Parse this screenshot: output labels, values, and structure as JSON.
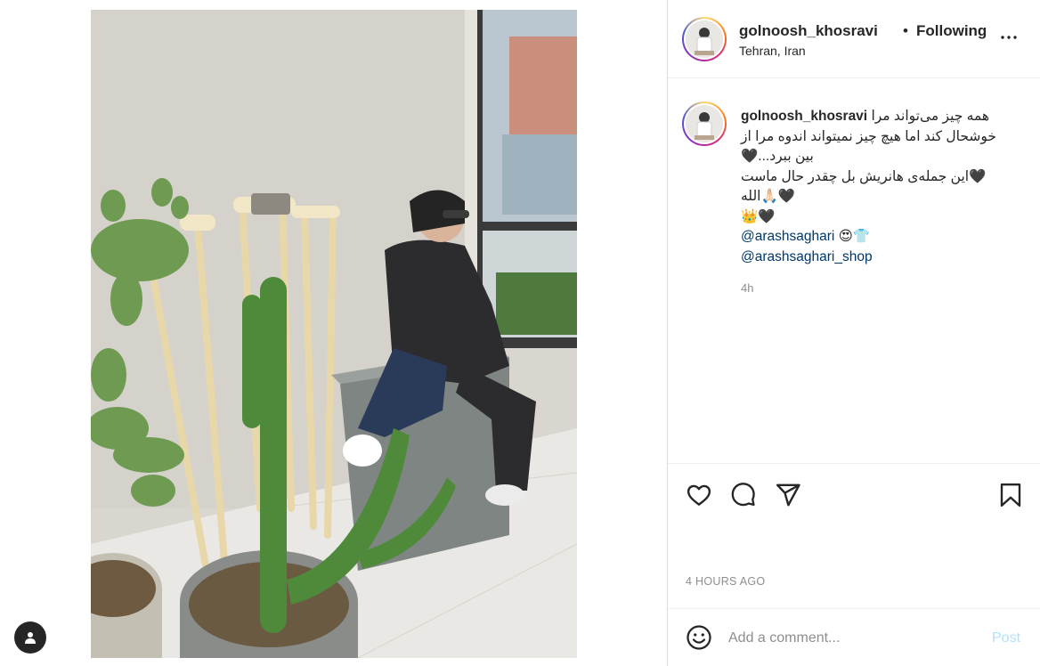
{
  "post": {
    "photo_alt": "",
    "tag_icon": "user-tag-icon"
  },
  "header": {
    "username": "golnoosh_khosravi",
    "separator": "•",
    "follow_status": "Following",
    "location": "Tehran, Iran",
    "more_icon": "more-options-icon"
  },
  "caption": {
    "username": "golnoosh_khosravi",
    "lines": [
      "همه چیز می‌تواند مرا",
      "خوشحال کند اما هیچ چیز نمیتواند اندوه مرا از",
      "بین ببرد...🖤",
      "🖤این جمله‌ی هانریش بل چقدر حال ماست",
      "🖤🙏🏻الله",
      "👑🖤"
    ],
    "mention_1": "@arashsaghari",
    "mention_1_emoji": "😍👕",
    "mention_2": "@arashsaghari_shop",
    "time": "4h"
  },
  "actions": {
    "like_icon": "heart-icon",
    "comment_icon": "comment-icon",
    "share_icon": "share-icon",
    "save_icon": "bookmark-icon"
  },
  "date": "4 HOURS AGO",
  "comment": {
    "emoji_icon": "emoji-icon",
    "placeholder": "Add a comment...",
    "post_label": "Post"
  },
  "colors": {
    "link": "#00376b",
    "muted": "#8e8e8e",
    "post_disabled": "#b2dffc",
    "border": "#dbdbdb"
  }
}
